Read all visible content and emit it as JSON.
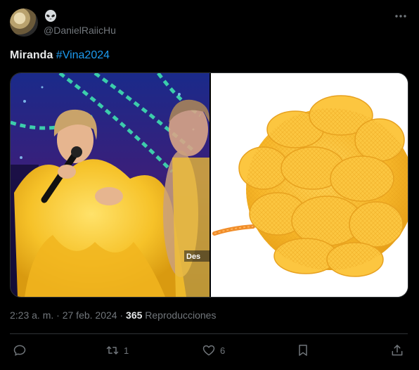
{
  "author": {
    "handle": "@DanielRaiicHu",
    "avatar_icon": "avatar-photo",
    "badge_icon": "alien-emoji"
  },
  "tweet": {
    "name_text": "Miranda",
    "hashtag": "#Vina2024"
  },
  "media": {
    "left_caption": "Des",
    "left_description_icon": "singer-in-yellow-tulle",
    "right_description_icon": "yellow-bath-sponge"
  },
  "meta": {
    "time": "2:23 a. m.",
    "sep1": " · ",
    "date": "27 feb. 2024",
    "sep2": " · ",
    "views": "365",
    "views_label": " Reproducciones"
  },
  "actions": {
    "reply_count": "",
    "retweet_count": "1",
    "like_count": "6"
  },
  "colors": {
    "accent": "#1d9bf0",
    "muted": "#71767b",
    "text": "#e7e9ea",
    "bg": "#000000",
    "border": "#2f3336"
  }
}
